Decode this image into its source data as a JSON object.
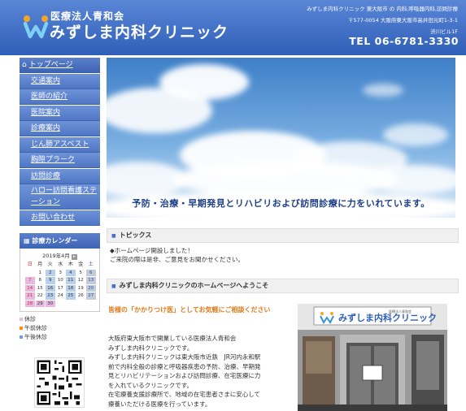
{
  "header": {
    "org": "医療法人青和会",
    "name": "みずしま内科クリニック",
    "info_line1": "みずしま内科クリニック 東大阪市 の 内科,呼吸器内科,訪問診療",
    "info_line2": "〒577-0054 大阪府東大阪市高井田元町1-3-1",
    "info_line3": "渋川ビル1F",
    "tel": "TEL 06-6781-3330"
  },
  "nav": {
    "items": [
      {
        "label": "トップページ"
      },
      {
        "label": "交通案内"
      },
      {
        "label": "医師の紹介"
      },
      {
        "label": "医院案内"
      },
      {
        "label": "診療案内"
      },
      {
        "label": "じん肺アスベスト"
      },
      {
        "label": "胸隙プラーク"
      },
      {
        "label": "訪問診療"
      },
      {
        "label": "ハロー訪問看護ステーション"
      },
      {
        "label": "お問い合わせ"
      }
    ]
  },
  "calendar": {
    "heading": "診療カレンダー",
    "month": "2019年4月",
    "weekdays": [
      "日",
      "月",
      "火",
      "水",
      "木",
      "金",
      "土"
    ],
    "legend": [
      "休診",
      "午前休診",
      "午後休診"
    ],
    "colors": {
      "off": "#e7b8e0",
      "am": "#b9d0ec",
      "pm": "#c2cbd6"
    }
  },
  "hero": {
    "text": "予防・治療・早期発見とリハビリおよび訪問診療に力をいれています。"
  },
  "topics": {
    "heading": "トピックス",
    "line1": "◆ホームページ開設しました！",
    "line2": "ご来院の際は是非、ご意見をお聞かせください。"
  },
  "welcome": {
    "heading": "みずしま内科クリニックのホームページへようこそ",
    "tagline": "皆様の「かかりつけ医」としてお気軽にご相談ください",
    "body": [
      "大阪府東大阪市で開業している医療法人青和会",
      "みずしま内科クリニックです。",
      "みずしま内科クリニックは東大阪市近鉄　JR河内永和駅",
      "前で内科全般の診療と呼吸器疾患の予防、治療、早期発",
      "見とリハビリテーションおよび訪問診療、在宅医療に力",
      "を入れているクリニックです。",
      "在宅療養支援診療所で、地域の在宅患者さまに安心して",
      "療養いただける医療を行っています。"
    ]
  },
  "photo": {
    "sign_text": "みずしま内科クリニック",
    "sign_sub": "医療法人青和会"
  }
}
